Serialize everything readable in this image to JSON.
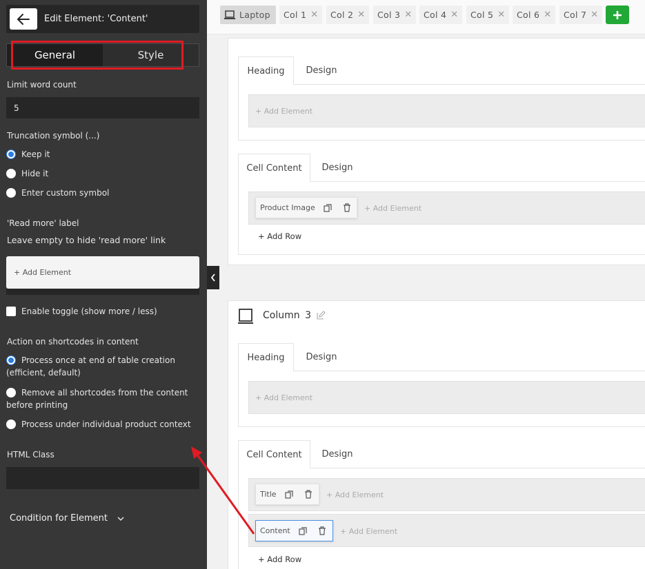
{
  "sidebar": {
    "title": "Edit Element: 'Content'",
    "tabs": {
      "general": "General",
      "style": "Style"
    },
    "limit_word_count": {
      "label": "Limit word count",
      "value": "5"
    },
    "truncation": {
      "label": "Truncation symbol (...)",
      "options": [
        "Keep it",
        "Hide it",
        "Enter custom symbol"
      ],
      "selected": "Keep it"
    },
    "read_more": {
      "label": "'Read more' label",
      "hint": "Leave empty to hide 'read more' link",
      "add_element": "+ Add Element"
    },
    "enable_toggle": "Enable toggle (show more / less)",
    "shortcodes": {
      "label": "Action on shortcodes in content",
      "options": [
        "Process once at end of table creation (efficient, default)",
        "Remove all shortcodes from the content before printing",
        "Process under individual product context"
      ],
      "selected": "Process once at end of table creation (efficient, default)"
    },
    "html_class": {
      "label": "HTML Class",
      "value": ""
    },
    "condition": "Condition for Element"
  },
  "toolbar": {
    "device": "Laptop",
    "columns": [
      "Col 1",
      "Col 2",
      "Col 3",
      "Col 4",
      "Col 5",
      "Col 6",
      "Col 7"
    ]
  },
  "main": {
    "card1": {
      "heading_tabs": [
        "Heading",
        "Design"
      ],
      "heading_add": "+ Add Element",
      "cell_tabs": [
        "Cell Content",
        "Design"
      ],
      "element": "Product Image",
      "cell_add": "+ Add Element",
      "add_row": "+ Add Row"
    },
    "card2": {
      "column_label": "Column",
      "column_number": "3",
      "heading_tabs": [
        "Heading",
        "Design"
      ],
      "heading_add": "+ Add Element",
      "cell_tabs": [
        "Cell Content",
        "Design"
      ],
      "rows": [
        {
          "element": "Title",
          "add": "+ Add Element"
        },
        {
          "element": "Content",
          "add": "+ Add Element"
        }
      ],
      "add_row": "+ Add Row"
    }
  },
  "colors": {
    "accent_blue": "#2a7de1",
    "highlight_red": "#e01b24",
    "add_green": "#22a836",
    "sidebar_bg": "#373737"
  }
}
